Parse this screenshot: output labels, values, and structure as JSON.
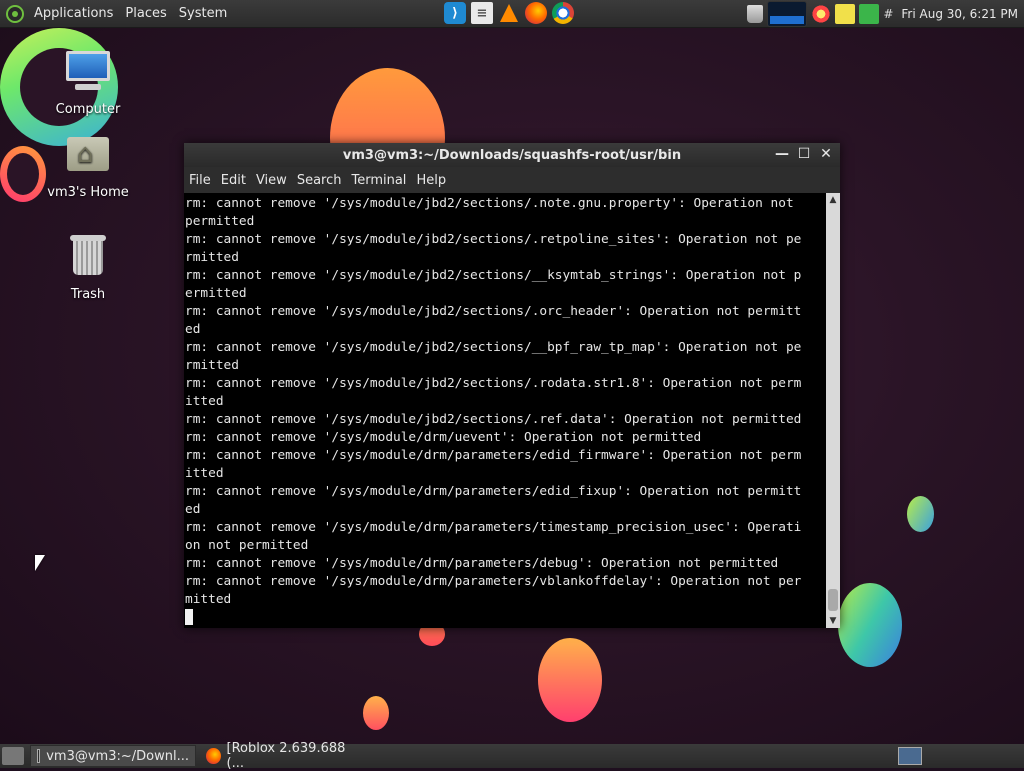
{
  "top_panel": {
    "menus": [
      "Applications",
      "Places",
      "System"
    ],
    "launchers": [
      "vscode-icon",
      "files-icon",
      "vlc-icon",
      "firefox-icon",
      "chrome-icon"
    ],
    "tray_hash": "#",
    "clock": "Fri Aug 30,  6:21 PM"
  },
  "desktop": {
    "icons": [
      {
        "label": "Computer"
      },
      {
        "label": "vm3's Home"
      },
      {
        "label": "Trash"
      }
    ]
  },
  "terminal": {
    "title": "vm3@vm3:~/Downloads/squashfs-root/usr/bin",
    "menu": [
      "File",
      "Edit",
      "View",
      "Search",
      "Terminal",
      "Help"
    ],
    "lines": [
      "rm: cannot remove '/sys/module/jbd2/sections/.note.gnu.property': Operation not ",
      "permitted",
      "rm: cannot remove '/sys/module/jbd2/sections/.retpoline_sites': Operation not pe",
      "rmitted",
      "rm: cannot remove '/sys/module/jbd2/sections/__ksymtab_strings': Operation not p",
      "ermitted",
      "rm: cannot remove '/sys/module/jbd2/sections/.orc_header': Operation not permitt",
      "ed",
      "rm: cannot remove '/sys/module/jbd2/sections/__bpf_raw_tp_map': Operation not pe",
      "rmitted",
      "rm: cannot remove '/sys/module/jbd2/sections/.rodata.str1.8': Operation not perm",
      "itted",
      "rm: cannot remove '/sys/module/jbd2/sections/.ref.data': Operation not permitted",
      "rm: cannot remove '/sys/module/drm/uevent': Operation not permitted",
      "rm: cannot remove '/sys/module/drm/parameters/edid_firmware': Operation not perm",
      "itted",
      "rm: cannot remove '/sys/module/drm/parameters/edid_fixup': Operation not permitt",
      "ed",
      "rm: cannot remove '/sys/module/drm/parameters/timestamp_precision_usec': Operati",
      "on not permitted",
      "rm: cannot remove '/sys/module/drm/parameters/debug': Operation not permitted",
      "rm: cannot remove '/sys/module/drm/parameters/vblankoffdelay': Operation not per",
      "mitted"
    ]
  },
  "bottom_panel": {
    "tasks": [
      {
        "label": "vm3@vm3:~/Downl..."
      },
      {
        "label": "[Roblox 2.639.688 (..."
      }
    ]
  }
}
